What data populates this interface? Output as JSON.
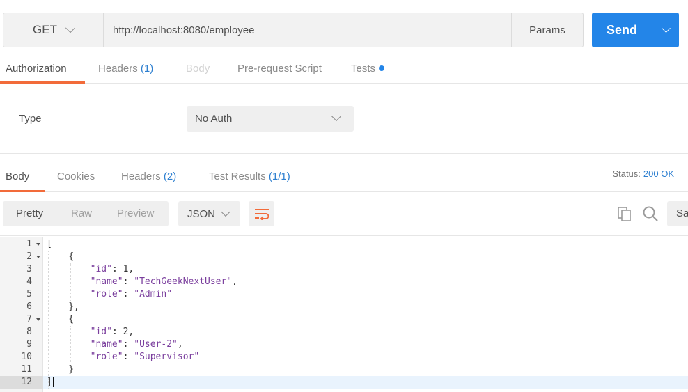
{
  "request": {
    "method": "GET",
    "url": "http://localhost:8080/employee",
    "params_label": "Params",
    "send_label": "Send"
  },
  "request_tabs": {
    "authorization": "Authorization",
    "headers": "Headers",
    "headers_count": "(1)",
    "body": "Body",
    "prerequest": "Pre-request Script",
    "tests": "Tests"
  },
  "auth": {
    "type_label": "Type",
    "type_value": "No Auth"
  },
  "response_tabs": {
    "body": "Body",
    "cookies": "Cookies",
    "headers": "Headers",
    "headers_count": "(2)",
    "test_results": "Test Results",
    "test_results_count": "(1/1)"
  },
  "status": {
    "label": "Status:",
    "value": "200 OK"
  },
  "response_toolbar": {
    "pretty": "Pretty",
    "raw": "Raw",
    "preview": "Preview",
    "format": "JSON",
    "save_label": "Save"
  },
  "colors": {
    "accent_send": "#2385e8",
    "active_tab_underline": "#f26b3a",
    "count_blue": "#2d7fd0"
  },
  "icons": {
    "method_dropdown": "chevron-down-icon",
    "send_dropdown": "chevron-down-icon",
    "wrap": "wrap-lines-icon",
    "copy": "copy-icon",
    "search": "search-icon"
  },
  "editor": {
    "lines": [
      {
        "n": "1",
        "fold": true,
        "text": "["
      },
      {
        "n": "2",
        "fold": true,
        "text": "    {"
      },
      {
        "n": "3",
        "fold": false,
        "key": "id",
        "value": "1",
        "vtype": "number",
        "comma": true
      },
      {
        "n": "4",
        "fold": false,
        "key": "name",
        "value": "TechGeekNextUser",
        "vtype": "string",
        "comma": true
      },
      {
        "n": "5",
        "fold": false,
        "key": "role",
        "value": "Admin",
        "vtype": "string",
        "comma": false
      },
      {
        "n": "6",
        "fold": false,
        "text": "    },"
      },
      {
        "n": "7",
        "fold": true,
        "text": "    {"
      },
      {
        "n": "8",
        "fold": false,
        "key": "id",
        "value": "2",
        "vtype": "number",
        "comma": true
      },
      {
        "n": "9",
        "fold": false,
        "key": "name",
        "value": "User-2",
        "vtype": "string",
        "comma": true
      },
      {
        "n": "10",
        "fold": false,
        "key": "role",
        "value": "Supervisor",
        "vtype": "string",
        "comma": false
      },
      {
        "n": "11",
        "fold": false,
        "text": "    }"
      },
      {
        "n": "12",
        "fold": false,
        "text": "]",
        "current": true
      }
    ]
  }
}
